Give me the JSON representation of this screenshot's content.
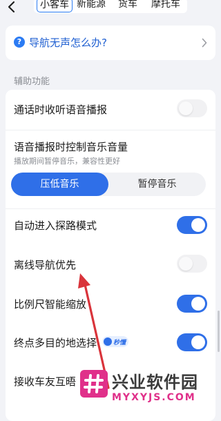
{
  "header": {
    "tabs": [
      "小客车",
      "新能源",
      "货车",
      "摩托车"
    ],
    "active_tab": "小客车"
  },
  "help_card": {
    "icon_name": "question-icon",
    "text": "导航无声怎么办?"
  },
  "section": {
    "title": "辅助功能"
  },
  "settings": {
    "call_voice": {
      "label": "通话时收听语音播报",
      "enabled": false
    },
    "music_control": {
      "label": "语音播报时控制音乐音量",
      "sub": "播放期间暂停音乐，兼容性更好",
      "options": [
        "压低音乐",
        "暂停音乐"
      ],
      "selected": "压低音乐"
    },
    "auto_explore": {
      "label": "自动进入探路模式",
      "enabled": true
    },
    "offline_first": {
      "label": "离线导航优先",
      "enabled": false
    },
    "scale_zoom": {
      "label": "比例尺智能缩放",
      "enabled": true
    },
    "multi_dest": {
      "label": "终点多目的地选择",
      "enabled": true,
      "badge": "秒懂"
    },
    "friend_interact": {
      "label": "接收车友互晤"
    }
  },
  "watermark": {
    "logo_icon": "hash-logo-icon",
    "title": "兴业软件园",
    "url": "MYXYJS.COM"
  },
  "colors": {
    "accent": "#2f6fe8",
    "link": "#1f5fd1",
    "annotation_arrow": "#d9343b",
    "watermark": "#e0308a"
  }
}
